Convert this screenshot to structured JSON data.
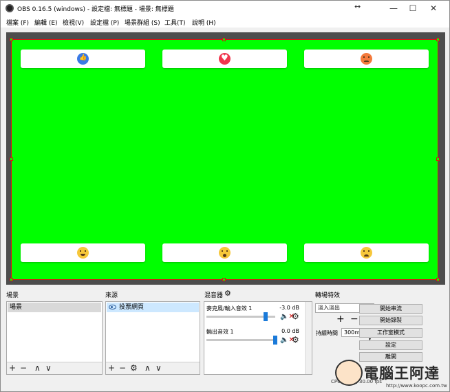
{
  "window": {
    "title": "OBS 0.16.5 (windows) - 設定檔: 無標題 - 場景: 無標題",
    "minimize": "—",
    "maximize": "☐",
    "close": "✕",
    "resize_glyph": "↔"
  },
  "menu": [
    {
      "label": "檔案 (F)"
    },
    {
      "label": "編輯 (E)"
    },
    {
      "label": "檢視(V)"
    },
    {
      "label": "設定檔 (P)"
    },
    {
      "label": "場景群組 (S)"
    },
    {
      "label": "工具(T)"
    },
    {
      "label": "說明 (H)"
    }
  ],
  "preview": {
    "background_color": "#00ff00",
    "reactions_top": [
      "like",
      "love",
      "angry"
    ],
    "reactions_bottom": [
      "haha",
      "wow",
      "sad"
    ]
  },
  "scenes": {
    "title": "場景",
    "items": [
      "場景"
    ]
  },
  "sources": {
    "title": "來源",
    "items": [
      "投票網頁"
    ]
  },
  "mixer": {
    "title": "混音器",
    "channels": [
      {
        "name": "麥克風/輸入音效 1",
        "db": "-3.0 dB",
        "volume": 0.86
      },
      {
        "name": "輸出音效 1",
        "db": "0.0 dB",
        "volume": 1.0
      }
    ]
  },
  "transitions": {
    "title": "轉場特效",
    "selected": "淡入淡出",
    "duration_label": "持續時間",
    "duration_value": "300ms"
  },
  "controls": [
    "開始串流",
    "開始錄製",
    "工作室模式",
    "設定",
    "離開"
  ],
  "status": {
    "cpu": "CPU: 0.8%, 30.00 fps"
  },
  "watermark": {
    "text": "電腦王阿達",
    "url": "http://www.koopc.com.tw"
  }
}
